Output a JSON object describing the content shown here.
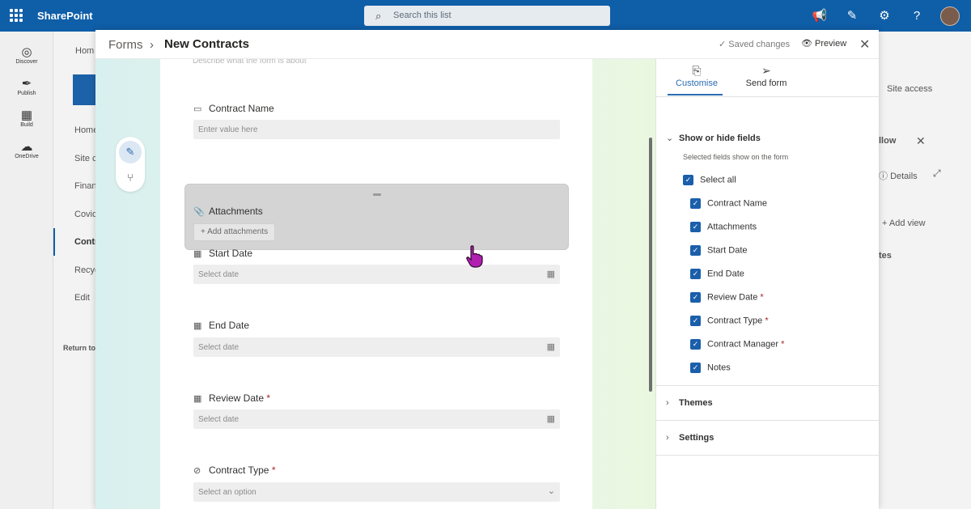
{
  "suitebar": {
    "brand": "SharePoint",
    "search_placeholder": "Search this list"
  },
  "rail": {
    "items": [
      {
        "label": "Discover"
      },
      {
        "label": "Publish"
      },
      {
        "label": "Build"
      },
      {
        "label": "OneDrive"
      }
    ]
  },
  "background": {
    "nav_items": [
      "Hom",
      "Home",
      "Site c",
      "Finan",
      "Covid",
      "Contr",
      "Recyc",
      "Edit",
      "Return to"
    ],
    "right_texts": [
      "Site access",
      "llow",
      "Details",
      "Add view",
      "tes"
    ]
  },
  "modal": {
    "breadcrumb_root": "Forms",
    "breadcrumb_sep": "›",
    "title": "New Contracts",
    "saved_status": "Saved changes",
    "preview_label": "Preview"
  },
  "form": {
    "description_placeholder": "Describe what the form is about",
    "fields": {
      "contract_name": {
        "label": "Contract Name",
        "placeholder": "Enter value here"
      },
      "attachments": {
        "label": "Attachments",
        "button": "Add attachments"
      },
      "start_date": {
        "label": "Start Date",
        "placeholder": "Select date"
      },
      "end_date": {
        "label": "End Date",
        "placeholder": "Select date"
      },
      "review_date": {
        "label": "Review Date",
        "required_mark": "*",
        "placeholder": "Select date"
      },
      "contract_type": {
        "label": "Contract Type",
        "required_mark": "*",
        "placeholder": "Select an option"
      }
    }
  },
  "panel": {
    "tabs": [
      {
        "label": "Customise",
        "active": true
      },
      {
        "label": "Send form",
        "active": false
      }
    ],
    "show_hide": {
      "title": "Show or hide fields",
      "subtitle": "Selected fields show on the form",
      "select_all": "Select all",
      "fields": [
        {
          "label": "Contract Name",
          "required": false
        },
        {
          "label": "Attachments",
          "required": false
        },
        {
          "label": "Start Date",
          "required": false
        },
        {
          "label": "End Date",
          "required": false
        },
        {
          "label": "Review Date",
          "required": true
        },
        {
          "label": "Contract Type",
          "required": true
        },
        {
          "label": "Contract Manager",
          "required": true
        },
        {
          "label": "Notes",
          "required": false
        }
      ],
      "required_mark": "*"
    },
    "themes_label": "Themes",
    "settings_label": "Settings"
  },
  "colors": {
    "suitebar": "#0f5ea8",
    "accent": "#2b6cb0",
    "checkbox": "#1b5fab",
    "required": "#a4262c"
  }
}
